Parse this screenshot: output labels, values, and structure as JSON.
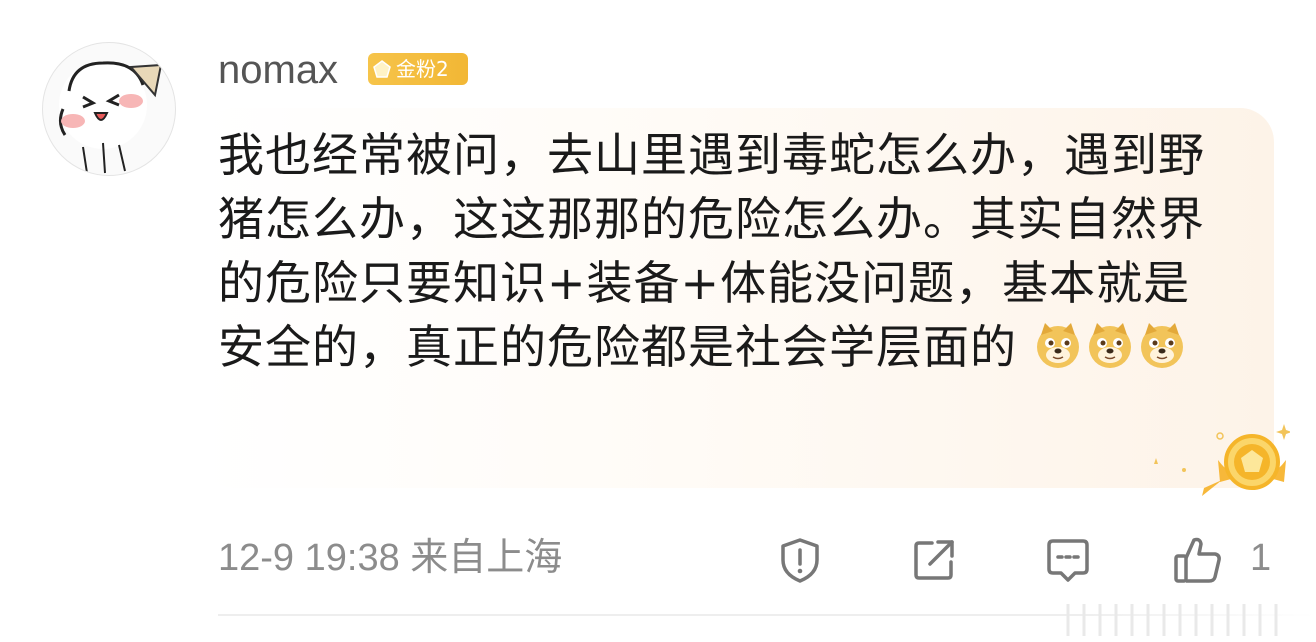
{
  "comment": {
    "username": "nomax",
    "badge_label": "金粉2",
    "text": "我也经常被问，去山里遇到毒蛇怎么办，遇到野猪怎么办，这这那那的危险怎么办。其实自然界的危险只要知识+装备+体能没问题，基本就是安全的，真正的危险都是社会学层面的",
    "emojis": [
      "doge-emoji",
      "doge-emoji",
      "doge-emoji"
    ],
    "meta": "12-9 19:38 来自上海",
    "like_count": "1"
  },
  "icons": {
    "avatar": "cartoon-avatar",
    "report": "report-icon",
    "share": "share-icon",
    "reply": "comment-icon",
    "like": "thumbs-up-icon",
    "medal": "fan-medal-icon"
  },
  "colors": {
    "badge": "#f2b735",
    "meta_text": "#8c8c8c",
    "body_text": "#1a1a1a"
  }
}
